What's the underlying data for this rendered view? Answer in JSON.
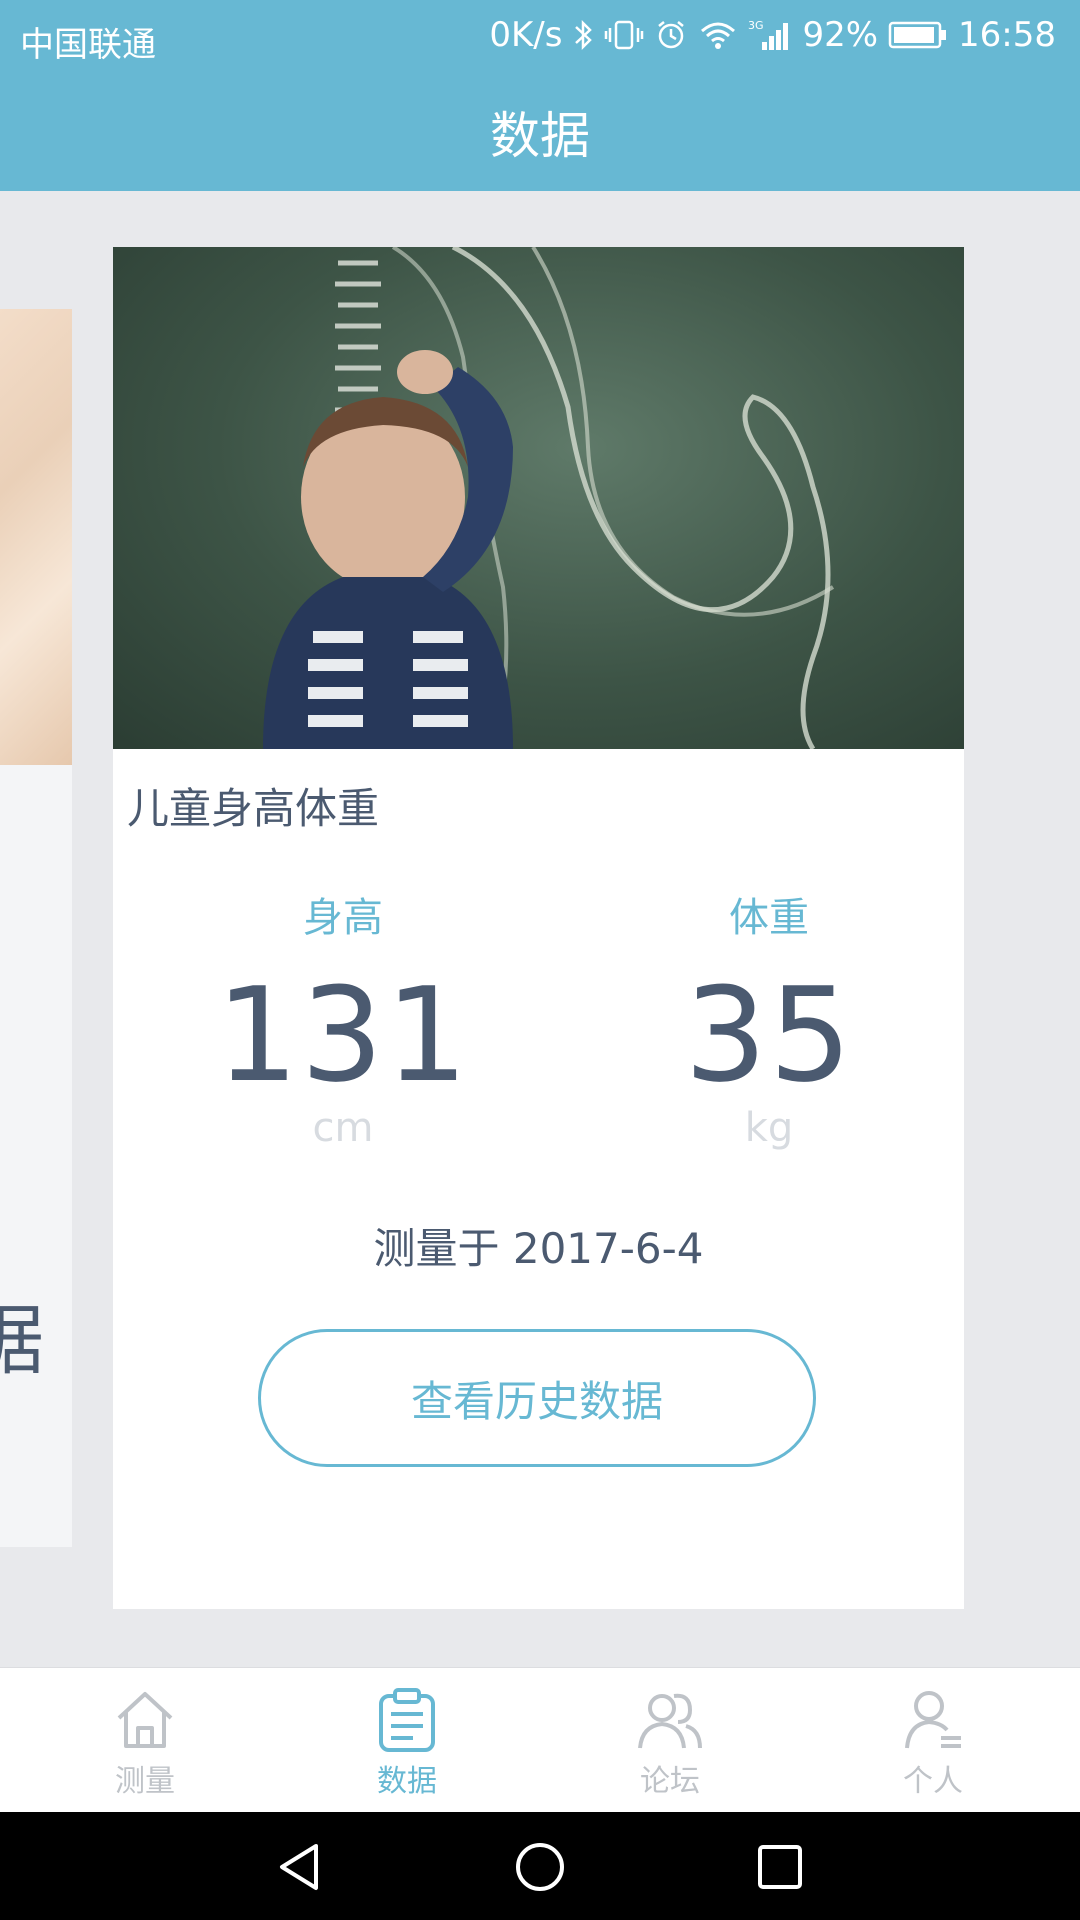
{
  "status_bar": {
    "carrier": "中国联通",
    "net_speed": "0K/s",
    "network_type": "3G",
    "battery": "92%",
    "time": "16:58"
  },
  "header": {
    "title": "数据"
  },
  "peek_card": {
    "partial_text": "据"
  },
  "card": {
    "title": "儿童身高体重",
    "height": {
      "label": "身高",
      "value": "131",
      "unit": "cm"
    },
    "weight": {
      "label": "体重",
      "value": "35",
      "unit": "kg"
    },
    "measured_text": "测量于 2017-6-4",
    "history_button": "查看历史数据"
  },
  "tabs": [
    {
      "label": "测量",
      "icon": "home-icon",
      "active": false
    },
    {
      "label": "数据",
      "icon": "clipboard-icon",
      "active": true
    },
    {
      "label": "论坛",
      "icon": "users-icon",
      "active": false
    },
    {
      "label": "个人",
      "icon": "person-icon",
      "active": false
    }
  ],
  "colors": {
    "primary": "#67b8d3",
    "text": "#4b5a70",
    "inactive": "#bfc3c8",
    "background": "#e8e9ec"
  }
}
